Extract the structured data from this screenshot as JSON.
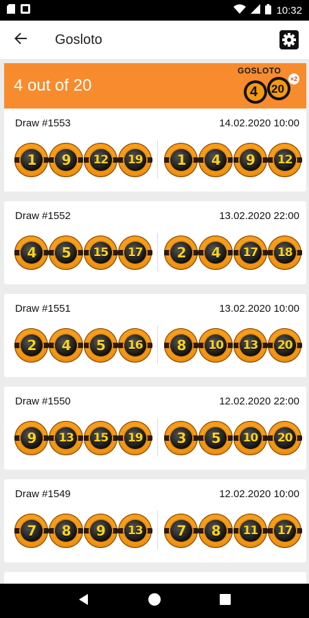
{
  "status_bar": {
    "time": "10:32",
    "icons": [
      "sd-card-icon",
      "notification-icon",
      "wifi-icon",
      "signal-icon",
      "battery-icon"
    ]
  },
  "app_bar": {
    "title": "Gosloto",
    "back_icon": "arrow-back-icon",
    "settings_icon": "gear-icon"
  },
  "banner": {
    "title": "4 out of 20",
    "logo_text": "GOSLOTO",
    "logo_ball_1": "4",
    "logo_ball_2": "20",
    "logo_multiplier": "×2",
    "color": "#f78b2d"
  },
  "draws": [
    {
      "label": "Draw #1553",
      "date": "14.02.2020 10:00",
      "field1": [
        "1",
        "9",
        "12",
        "19"
      ],
      "field2": [
        "1",
        "4",
        "9",
        "12"
      ]
    },
    {
      "label": "Draw #1552",
      "date": "13.02.2020 22:00",
      "field1": [
        "4",
        "5",
        "15",
        "17"
      ],
      "field2": [
        "2",
        "4",
        "17",
        "18"
      ]
    },
    {
      "label": "Draw #1551",
      "date": "13.02.2020 10:00",
      "field1": [
        "2",
        "4",
        "5",
        "16"
      ],
      "field2": [
        "8",
        "10",
        "13",
        "20"
      ]
    },
    {
      "label": "Draw #1550",
      "date": "12.02.2020 22:00",
      "field1": [
        "9",
        "13",
        "15",
        "19"
      ],
      "field2": [
        "3",
        "5",
        "10",
        "20"
      ]
    },
    {
      "label": "Draw #1549",
      "date": "12.02.2020 10:00",
      "field1": [
        "7",
        "8",
        "9",
        "13"
      ],
      "field2": [
        "7",
        "8",
        "11",
        "17"
      ]
    }
  ],
  "nav_bar": {
    "icons": [
      "back-triangle-icon",
      "home-circle-icon",
      "recents-square-icon"
    ]
  }
}
